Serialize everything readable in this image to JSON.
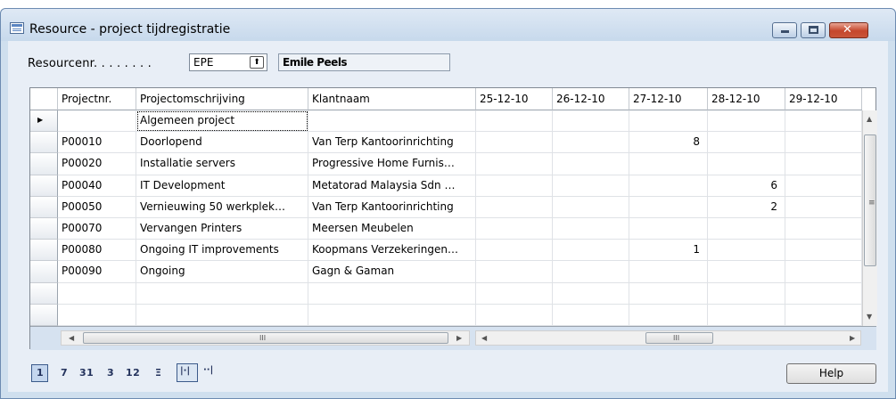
{
  "window": {
    "title": "Resource - project tijdregistratie",
    "buttons": [
      "minimize",
      "maximize",
      "close"
    ]
  },
  "resource": {
    "label": "Resourcenr. . . . . . . .",
    "value": "EPE",
    "lookup_symbol": "⬆",
    "name": "Emile Peels"
  },
  "grid": {
    "columns": [
      "Projectnr.",
      "Projectomschrijving",
      "Klantnaam",
      "25-12-10",
      "26-12-10",
      "27-12-10",
      "28-12-10",
      "29-12-10"
    ],
    "current_row_marker": "▶",
    "rows": [
      {
        "nr": "",
        "desc": "Algemeen project",
        "klant": "",
        "d1": "",
        "d2": "",
        "d3": "",
        "d4": "",
        "d5": ""
      },
      {
        "nr": "P00010",
        "desc": "Doorlopend",
        "klant": "Van Terp Kantoorinrichting",
        "d1": "",
        "d2": "",
        "d3": "8",
        "d4": "",
        "d5": ""
      },
      {
        "nr": "P00020",
        "desc": "Installatie servers",
        "klant": "Progressive Home Furnis…",
        "d1": "",
        "d2": "",
        "d3": "",
        "d4": "",
        "d5": ""
      },
      {
        "nr": "P00040",
        "desc": "IT Development",
        "klant": "Metatorad Malaysia Sdn …",
        "d1": "",
        "d2": "",
        "d3": "",
        "d4": "6",
        "d5": ""
      },
      {
        "nr": "P00050",
        "desc": "Vernieuwing 50 werkplek…",
        "klant": "Van Terp Kantoorinrichting",
        "d1": "",
        "d2": "",
        "d3": "",
        "d4": "2",
        "d5": ""
      },
      {
        "nr": "P00070",
        "desc": "Vervangen Printers",
        "klant": "Meersen Meubelen",
        "d1": "",
        "d2": "",
        "d3": "",
        "d4": "",
        "d5": ""
      },
      {
        "nr": "P00080",
        "desc": "Ongoing IT improvements",
        "klant": "Koopmans Verzekeringen…",
        "d1": "",
        "d2": "",
        "d3": "1",
        "d4": "",
        "d5": ""
      },
      {
        "nr": "P00090",
        "desc": "Ongoing",
        "klant": "Gagn & Gaman",
        "d1": "",
        "d2": "",
        "d3": "",
        "d4": "",
        "d5": ""
      },
      {
        "nr": "",
        "desc": "",
        "klant": "",
        "d1": "",
        "d2": "",
        "d3": "",
        "d4": "",
        "d5": ""
      },
      {
        "nr": "",
        "desc": "",
        "klant": "",
        "d1": "",
        "d2": "",
        "d3": "",
        "d4": "",
        "d5": ""
      }
    ]
  },
  "period_buttons": [
    "1",
    "7",
    "31",
    "3",
    "12",
    "Ξ"
  ],
  "nav_icons": [
    "prev-period-icon",
    "next-period-icon"
  ],
  "help_label": "Help",
  "colors": {
    "frame": "#cfdfee",
    "content": "#e8eef6",
    "close": "#c5462c"
  }
}
